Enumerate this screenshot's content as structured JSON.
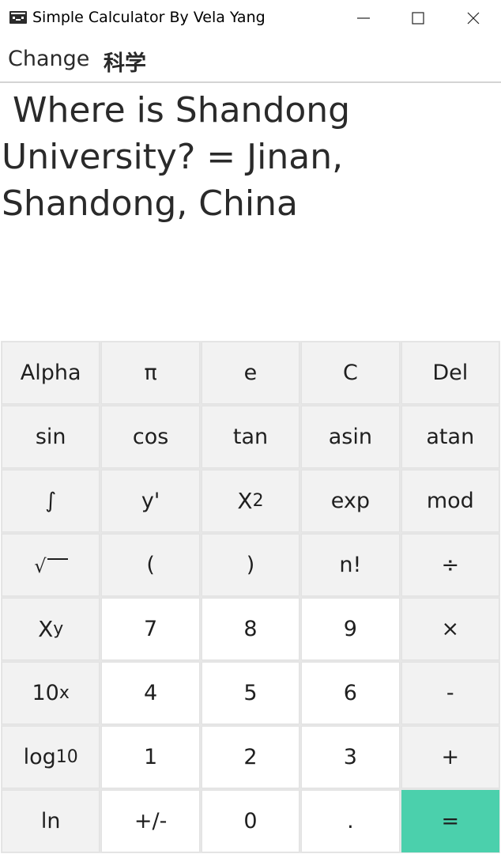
{
  "window": {
    "title": "Simple Calculator By Vela Yang",
    "controls": [
      "minimize-icon",
      "maximize-icon",
      "close-icon"
    ]
  },
  "toolbar": {
    "change_label": "Change",
    "mode_label": "科学"
  },
  "display": {
    "text": " Where is Shandong University? = Jinan, Shandong, China"
  },
  "keys": {
    "alpha": "Alpha",
    "pi": "π",
    "e": "e",
    "clear": "C",
    "del": "Del",
    "sin": "sin",
    "cos": "cos",
    "tan": "tan",
    "asin": "asin",
    "atan": "atan",
    "integral": "∫",
    "derivative": "y'",
    "square_base": "X",
    "square_exp": "2",
    "exp": "exp",
    "mod": "mod",
    "sqrt_symbol": "√",
    "open_paren": "(",
    "close_paren": ")",
    "factorial": "n!",
    "divide": "÷",
    "power_base": "X",
    "power_exp": "y",
    "seven": "7",
    "eight": "8",
    "nine": "9",
    "multiply": "×",
    "tenpow_base": "10",
    "tenpow_exp": "x",
    "four": "4",
    "five": "5",
    "six": "6",
    "minus": "-",
    "log_base_label": "log",
    "log_base_sub": "10",
    "one": "1",
    "two": "2",
    "three": "3",
    "plus": "+",
    "ln": "ln",
    "negate": "+/-",
    "zero": "0",
    "dot": ".",
    "equals": "="
  },
  "colors": {
    "equals_key": "#4bd0ac",
    "function_key": "#f2f2f2",
    "number_key": "#ffffff"
  }
}
